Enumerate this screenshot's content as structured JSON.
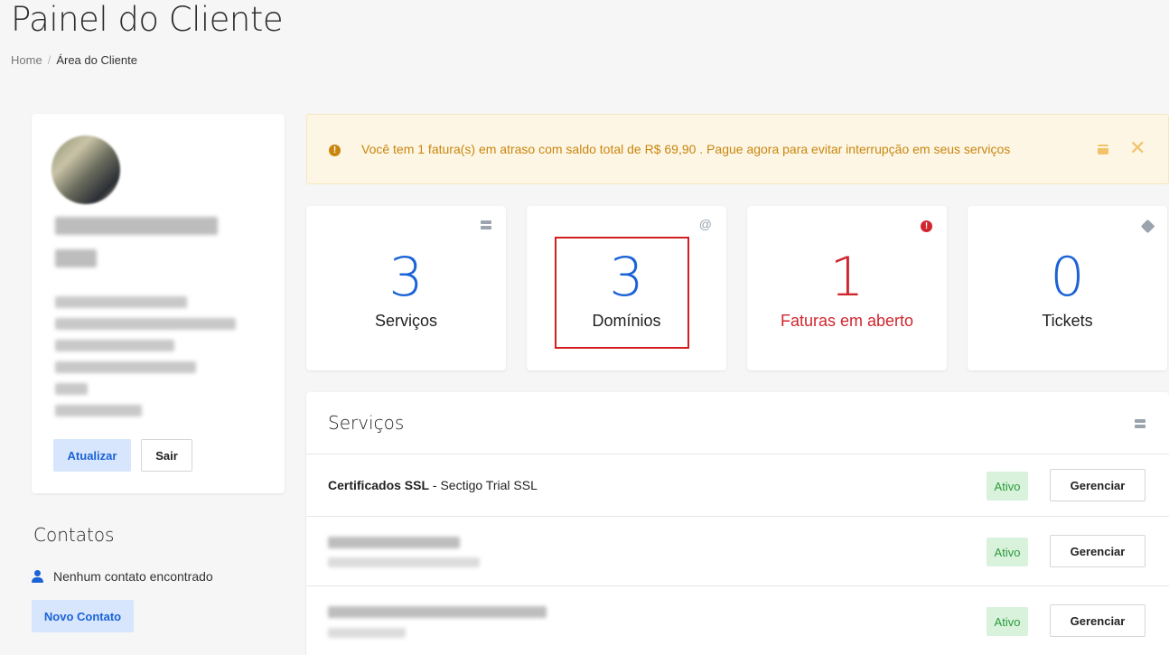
{
  "header": {
    "title": "Painel do Cliente",
    "breadcrumb": {
      "home": "Home",
      "separator": "/",
      "current": "Área do Cliente"
    }
  },
  "profile": {
    "update_label": "Atualizar",
    "logout_label": "Sair"
  },
  "contacts": {
    "title": "Contatos",
    "empty_text": "Nenhum contato encontrado",
    "new_label": "Novo Contato"
  },
  "alert": {
    "message": "Você tem 1 fatura(s) em atraso com saldo total de R$ 69,90 . Pague agora para evitar interrupção em seus serviços",
    "close_glyph": "✕",
    "icon_glyph": "!"
  },
  "stats": [
    {
      "value": "3",
      "label": "Serviços",
      "icon": "server-icon",
      "color": "#1a63d6"
    },
    {
      "value": "3",
      "label": "Domínios",
      "icon": "at-icon",
      "color": "#1a63d6"
    },
    {
      "value": "1",
      "label": "Faturas em aberto",
      "icon": "exclamation-icon",
      "color": "#d0262f"
    },
    {
      "value": "0",
      "label": "Tickets",
      "icon": "tag-icon",
      "color": "#1a63d6"
    }
  ],
  "stat_icons": {
    "at": "@",
    "excl": "!"
  },
  "services": {
    "title": "Serviços",
    "rows": [
      {
        "product": "Certificados SSL",
        "detail": " - Sectigo Trial SSL",
        "status": "Ativo",
        "action": "Gerenciar"
      },
      {
        "status": "Ativo",
        "action": "Gerenciar"
      },
      {
        "status": "Ativo",
        "action": "Gerenciar"
      }
    ]
  }
}
